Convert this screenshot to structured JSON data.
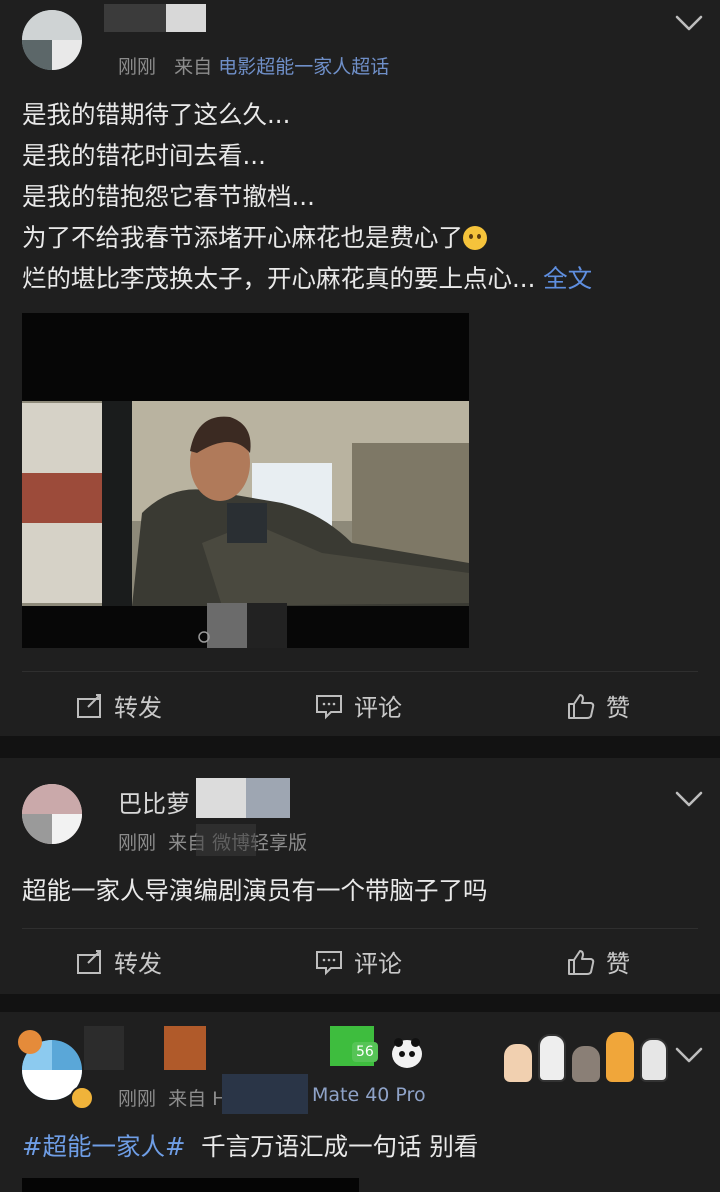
{
  "post1": {
    "meta_prefix": "刚刚",
    "meta_from": "来自",
    "meta_source": "电影超能一家人超话",
    "lines": [
      "是我的错期待了这么久...",
      "是我的错花时间去看...",
      "是我的错抱怨它春节撤档...",
      "为了不给我春节添堵开心麻花也是费心了",
      "烂的堪比李茂换太子，开心麻花真的要上点心..."
    ],
    "more_label": "全文",
    "actions": {
      "repost": "转发",
      "comment": "评论",
      "like": "赞"
    }
  },
  "post2": {
    "user_name": "巴比萝",
    "meta_prefix": "刚刚",
    "meta_from": "来自",
    "meta_source": "微博轻享版",
    "text": "超能一家人导演编剧演员有一个带脑子了吗",
    "actions": {
      "repost": "转发",
      "comment": "评论",
      "like": "赞"
    }
  },
  "post3": {
    "meta_prefix": "刚刚",
    "meta_from": "来自",
    "meta_source_partial": "H",
    "meta_device": "Mate 40 Pro",
    "tag": "#超能一家人#",
    "text": "千言万语汇成一句话  别看",
    "badge": "56"
  },
  "colors": {
    "accent": "#5f8fe0",
    "background": "#1f1f1f",
    "divider": "#121212"
  },
  "icons": [
    "chevron-down-icon",
    "share-icon",
    "comment-icon",
    "like-icon",
    "panda-icon",
    "cat-paw-icon",
    "weibo-watermark-icon"
  ]
}
